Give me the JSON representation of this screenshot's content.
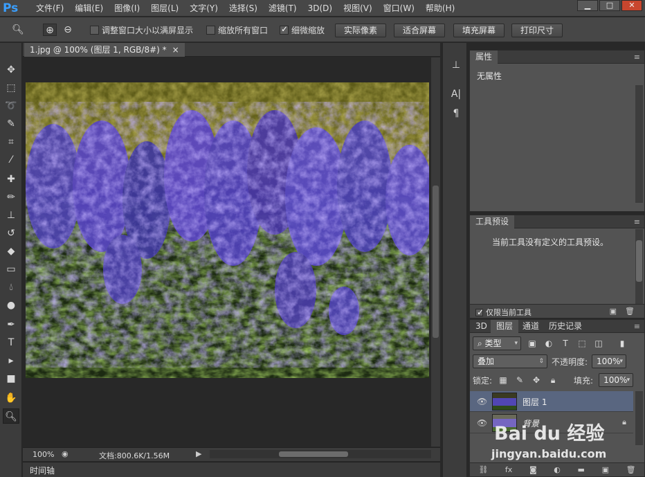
{
  "app": {
    "logo": "Ps"
  },
  "menu": [
    "文件(F)",
    "编辑(E)",
    "图像(I)",
    "图层(L)",
    "文字(Y)",
    "选择(S)",
    "滤镜(T)",
    "3D(D)",
    "视图(V)",
    "窗口(W)",
    "帮助(H)"
  ],
  "options": {
    "resize_window": "调整窗口大小以满屏显示",
    "zoom_all": "缩放所有窗口",
    "scrubby": "细微缩放",
    "actual_pixels": "实际像素",
    "fit_screen": "适合屏幕",
    "fill_screen": "填充屏幕",
    "print_size": "打印尺寸"
  },
  "document": {
    "tab_title": "1.jpg @ 100% (图层 1, RGB/8#) *",
    "close": "×",
    "zoom": "100%",
    "doc_info": "文档:800.6K/1.56M"
  },
  "timeline": {
    "label": "时间轴"
  },
  "properties": {
    "title": "属性",
    "empty": "无属性"
  },
  "tool_presets": {
    "title": "工具预设",
    "empty": "当前工具没有定义的工具预设。",
    "current_only": "仅限当前工具"
  },
  "layers": {
    "tabs": [
      "3D",
      "图层",
      "通道",
      "历史记录"
    ],
    "filter_type": "类型",
    "blend_mode": "叠加",
    "opacity_label": "不透明度:",
    "opacity": "100%",
    "lock_label": "锁定:",
    "fill_label": "填充:",
    "fill": "100%",
    "items": [
      {
        "name": "图层 1"
      },
      {
        "name": "背景"
      }
    ]
  },
  "watermark": {
    "logo": "Bai du 经验",
    "url": "jingyan.baidu.com"
  },
  "colors": {
    "accent": "#3a9fff",
    "selected_layer": "#596680"
  }
}
